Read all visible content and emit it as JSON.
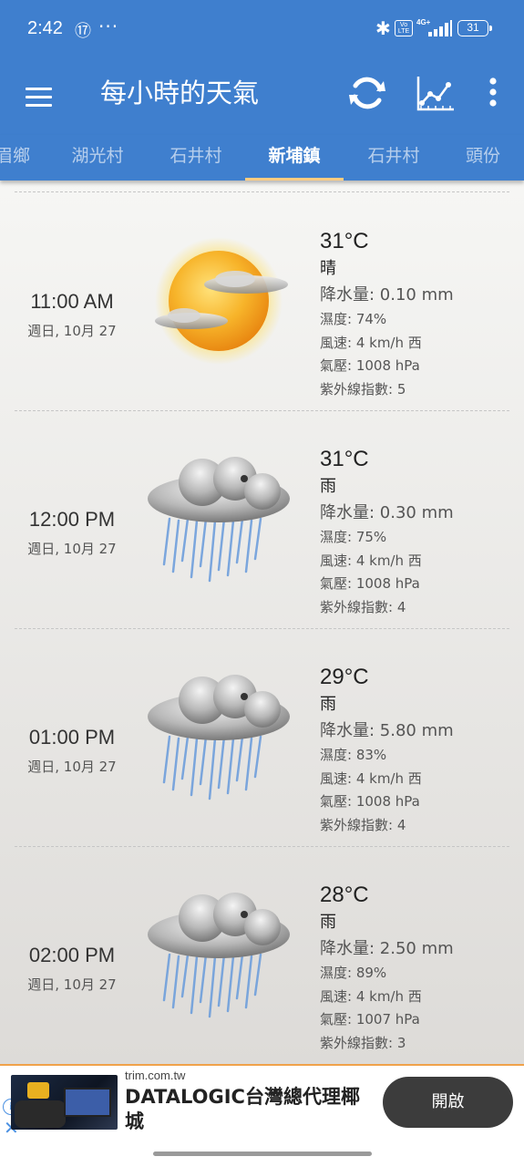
{
  "status_bar": {
    "time": "2:42",
    "app_icon": "⑰",
    "more": "···",
    "bluetooth": "✱",
    "volte": "Vo LTE",
    "network": "4G+",
    "battery": "31"
  },
  "app_bar": {
    "title": "每小時的天氣"
  },
  "tabs": [
    {
      "label": "眉鄉",
      "active": false
    },
    {
      "label": "湖光村",
      "active": false
    },
    {
      "label": "石井村",
      "active": false
    },
    {
      "label": "新埔鎮",
      "active": true
    },
    {
      "label": "石井村",
      "active": false
    },
    {
      "label": "頭份",
      "active": false
    }
  ],
  "forecast": [
    {
      "time": "11:00 AM",
      "date": "週日, 10月 27",
      "icon": "sunny-icon",
      "temp": "31°C",
      "condition": "晴",
      "precip": "降水量: 0.10 mm",
      "humidity": "濕度: 74%",
      "wind": "風速: 4 km/h 西",
      "pressure": "氣壓: 1008 hPa",
      "uv": "紫外線指數: 5"
    },
    {
      "time": "12:00 PM",
      "date": "週日, 10月 27",
      "icon": "rain-icon",
      "temp": "31°C",
      "condition": "雨",
      "precip": "降水量: 0.30 mm",
      "humidity": "濕度: 75%",
      "wind": "風速: 4 km/h 西",
      "pressure": "氣壓: 1008 hPa",
      "uv": "紫外線指數: 4"
    },
    {
      "time": "01:00 PM",
      "date": "週日, 10月 27",
      "icon": "rain-icon",
      "temp": "29°C",
      "condition": "雨",
      "precip": "降水量: 5.80 mm",
      "humidity": "濕度: 83%",
      "wind": "風速: 4 km/h 西",
      "pressure": "氣壓: 1008 hPa",
      "uv": "紫外線指數: 4"
    },
    {
      "time": "02:00 PM",
      "date": "週日, 10月 27",
      "icon": "rain-icon",
      "temp": "28°C",
      "condition": "雨",
      "precip": "降水量: 2.50 mm",
      "humidity": "濕度: 89%",
      "wind": "風速: 4 km/h 西",
      "pressure": "氣壓: 1007 hPa",
      "uv": "紫外線指數: 3"
    }
  ],
  "ad": {
    "domain": "trim.com.tw",
    "headline": "DATALOGIC台灣總代理椰城",
    "cta": "開啟"
  },
  "colors": {
    "primary": "#3f7fce",
    "tab_indicator": "#ffcc80",
    "ad_border": "#f0a24a"
  }
}
